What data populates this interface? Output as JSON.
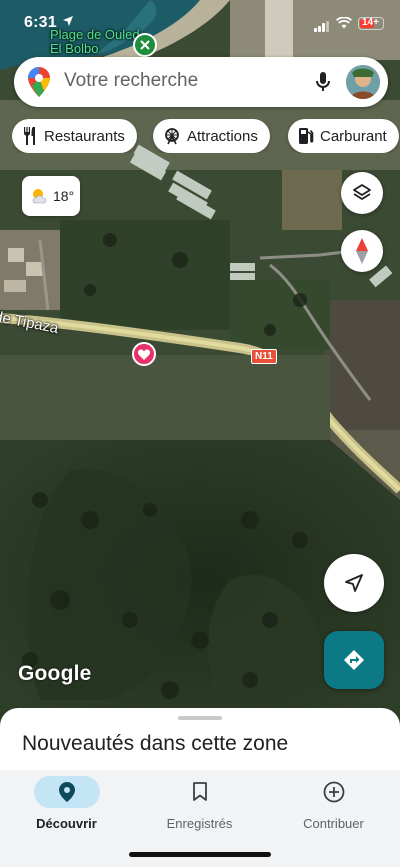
{
  "status_bar": {
    "time": "6:31",
    "battery_label": "14+",
    "location_icon": "location-arrow-icon",
    "signal_icon": "cellular-signal-icon",
    "wifi_icon": "wifi-icon",
    "battery_icon": "battery-icon",
    "battery_color": "#ff3b30"
  },
  "map": {
    "poi_label_top": "Plage de Ouled El Bolbo",
    "poi_top_icon": "pharmacy-icon",
    "road_label": "de Tipaza",
    "road_shield": "N11",
    "saved_place_icon": "heart-icon",
    "attribution": "Google"
  },
  "search": {
    "placeholder": "Votre recherche",
    "logo_icon": "google-maps-pin-icon",
    "mic_icon": "microphone-icon",
    "avatar_icon": "user-avatar"
  },
  "chips": [
    {
      "label": "Restaurants",
      "icon": "fork-knife-icon"
    },
    {
      "label": "Attractions",
      "icon": "ferris-wheel-icon"
    },
    {
      "label": "Carburant",
      "icon": "gas-pump-icon"
    }
  ],
  "weather": {
    "temperature": "18°",
    "icon": "partly-cloudy-icon"
  },
  "controls": {
    "layers_icon": "layers-icon",
    "compass_icon": "compass-icon",
    "locate_icon": "navigation-arrow-icon",
    "directions_icon": "directions-icon",
    "directions_color": "#0b7a86"
  },
  "sheet": {
    "title": "Nouveautés dans cette zone"
  },
  "nav": {
    "items": [
      {
        "label": "Découvrir",
        "icon": "location-pin-icon",
        "active": true
      },
      {
        "label": "Enregistrés",
        "icon": "bookmark-icon",
        "active": false
      },
      {
        "label": "Contribuer",
        "icon": "add-circle-icon",
        "active": false
      }
    ],
    "active_color": "#c3e5f5"
  }
}
